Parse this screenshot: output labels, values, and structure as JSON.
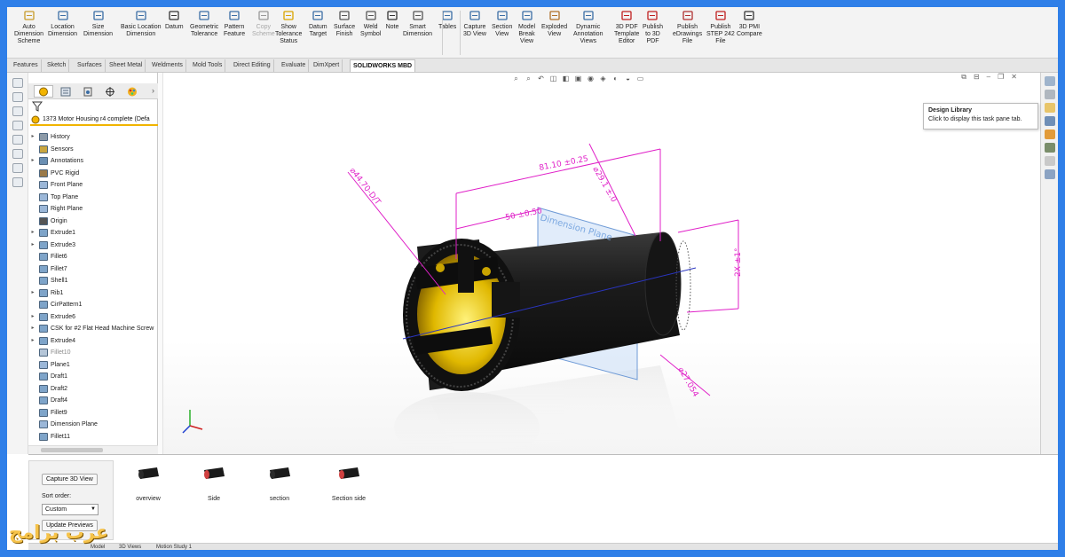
{
  "ribbon": {
    "buttons": [
      {
        "label": "Auto\nDimension\nScheme",
        "icon": "auto-dimension-icon"
      },
      {
        "label": "Location\nDimension",
        "icon": "location-dimension-icon"
      },
      {
        "label": "Size\nDimension",
        "icon": "size-dimension-icon"
      },
      {
        "label": "Basic Location\nDimension",
        "icon": "basic-location-dimension-icon"
      },
      {
        "label": "Datum",
        "icon": "datum-icon"
      },
      {
        "label": "Geometric\nTolerance",
        "icon": "geometric-tolerance-icon"
      },
      {
        "label": "Pattern\nFeature",
        "icon": "pattern-feature-icon"
      },
      {
        "label": "Copy\nScheme",
        "icon": "copy-scheme-icon"
      },
      {
        "label": "Show\nTolerance\nStatus",
        "icon": "tolerance-status-icon"
      },
      {
        "label": "Datum\nTarget",
        "icon": "datum-target-icon"
      },
      {
        "label": "Surface\nFinish",
        "icon": "surface-finish-icon"
      },
      {
        "label": "Weld\nSymbol",
        "icon": "weld-symbol-icon"
      },
      {
        "label": "Note",
        "icon": "note-icon"
      },
      {
        "label": "Smart\nDimension",
        "icon": "smart-dimension-icon"
      },
      {
        "label": "Tables",
        "icon": "tables-icon"
      },
      {
        "label": "Capture\n3D View",
        "icon": "capture-3d-view-icon"
      },
      {
        "label": "Section\nView",
        "icon": "section-view-icon"
      },
      {
        "label": "Model\nBreak\nView",
        "icon": "model-break-view-icon"
      },
      {
        "label": "Exploded\nView",
        "icon": "exploded-view-icon"
      },
      {
        "label": "Dynamic\nAnnotation\nViews",
        "icon": "dynamic-annotation-views-icon"
      },
      {
        "label": "3D PDF\nTemplate\nEditor",
        "icon": "pdf-template-editor-icon"
      },
      {
        "label": "Publish\nto 3D\nPDF",
        "icon": "publish-3d-pdf-icon"
      },
      {
        "label": "Publish\neDrawings\nFile",
        "icon": "publish-edrawings-icon"
      },
      {
        "label": "Publish\nSTEP 242\nFile",
        "icon": "publish-step-icon"
      },
      {
        "label": "3D PMI\nCompare",
        "icon": "pmi-compare-icon"
      }
    ]
  },
  "tabs": [
    "Features",
    "Sketch",
    "Surfaces",
    "Sheet Metal",
    "Weldments",
    "Mold Tools",
    "Direct Editing",
    "Evaluate",
    "DimXpert",
    "SOLIDWORKS MBD"
  ],
  "active_tab": "SOLIDWORKS MBD",
  "feature_tree": {
    "root": "1373 Motor Housing r4 complete  (Defa",
    "items": [
      {
        "label": "History",
        "arrow": "▸",
        "color": "#8c9aa8"
      },
      {
        "label": "Sensors",
        "arrow": "",
        "color": "#c9a640"
      },
      {
        "label": "Annotations",
        "arrow": "▸",
        "color": "#6a8fb3"
      },
      {
        "label": "PVC Rigid",
        "arrow": "",
        "color": "#9a7a4a"
      },
      {
        "label": "Front Plane",
        "arrow": "",
        "color": "#9bb7d8"
      },
      {
        "label": "Top Plane",
        "arrow": "",
        "color": "#9bb7d8"
      },
      {
        "label": "Right Plane",
        "arrow": "",
        "color": "#9bb7d8"
      },
      {
        "label": "Origin",
        "arrow": "",
        "color": "#555555"
      },
      {
        "label": "Extrude1",
        "arrow": "▸",
        "color": "#7ea4c9"
      },
      {
        "label": "Extrude3",
        "arrow": "▸",
        "color": "#7ea4c9"
      },
      {
        "label": "Fillet6",
        "arrow": "",
        "color": "#7ea4c9"
      },
      {
        "label": "Fillet7",
        "arrow": "",
        "color": "#7ea4c9"
      },
      {
        "label": "Shell1",
        "arrow": "",
        "color": "#7ea4c9"
      },
      {
        "label": "Rib1",
        "arrow": "▸",
        "color": "#7ea4c9"
      },
      {
        "label": "CirPattern1",
        "arrow": "",
        "color": "#7ea4c9"
      },
      {
        "label": "Extrude6",
        "arrow": "▸",
        "color": "#7ea4c9"
      },
      {
        "label": "CSK for #2 Flat Head Machine Screw",
        "arrow": "▸",
        "color": "#7ea4c9"
      },
      {
        "label": "Extrude4",
        "arrow": "▸",
        "color": "#7ea4c9"
      },
      {
        "label": "Fillet10",
        "arrow": "",
        "color": "#b5c6d8",
        "dim": true
      },
      {
        "label": "Plane1",
        "arrow": "",
        "color": "#9bb7d8"
      },
      {
        "label": "Draft1",
        "arrow": "",
        "color": "#7ea4c9"
      },
      {
        "label": "Draft2",
        "arrow": "",
        "color": "#7ea4c9"
      },
      {
        "label": "Draft4",
        "arrow": "",
        "color": "#7ea4c9"
      },
      {
        "label": "Fillet9",
        "arrow": "",
        "color": "#7ea4c9"
      },
      {
        "label": "Dimension Plane",
        "arrow": "",
        "color": "#9bb7d8"
      },
      {
        "label": "Fillet11",
        "arrow": "",
        "color": "#7ea4c9"
      }
    ]
  },
  "viewport": {
    "dimensions": {
      "length": "81.10 ±0.25",
      "offset": "50 ±0.50",
      "diameter_front": "⌀44.70-D/T",
      "diameter_top": "⌀29.1 ±.0",
      "diameter_bottom": "⌀27.054",
      "angle": "2X ±1°",
      "plane_label": "Dimension Plane"
    }
  },
  "tooltip": {
    "title": "Design Library",
    "body": "Click to display this task pane tab."
  },
  "bottom_panel": {
    "capture_label": "Capture 3D View",
    "sort_label": "Sort order:",
    "sort_value": "Custom",
    "update_label": "Update Previews",
    "views": [
      "overview",
      "Side",
      "section",
      "Section side"
    ]
  },
  "bottom_tabs": [
    "Model",
    "3D Views",
    "Motion Study 1"
  ],
  "watermark": "عرب برامج",
  "colors": {
    "accent": "#2f7fe8",
    "dimension": "#e020c8",
    "housing": "#1c1c1c",
    "interior": "#e0b800"
  }
}
